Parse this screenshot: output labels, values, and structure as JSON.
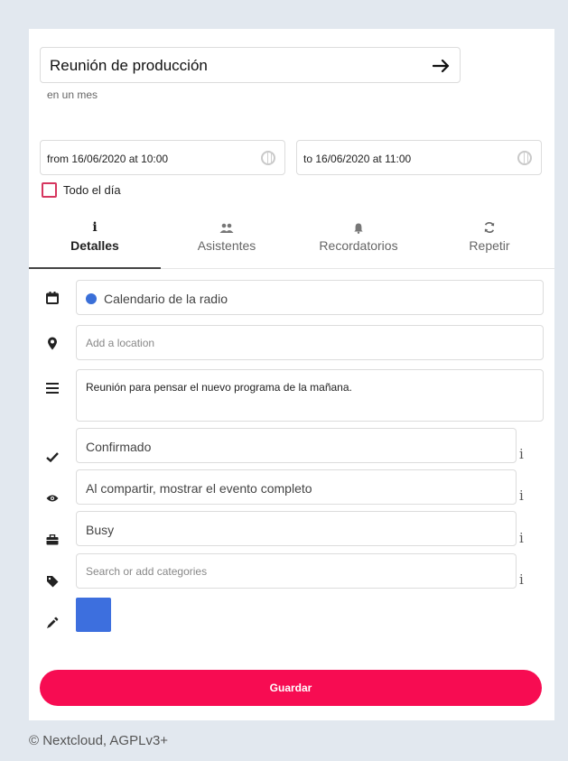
{
  "event": {
    "title": "Reunión de producción",
    "relative_time": "en un mes",
    "from": "from 16/06/2020 at 10:00",
    "to": "to 16/06/2020 at 11:00",
    "all_day_label": "Todo el día",
    "all_day_checked": false
  },
  "tabs": [
    {
      "icon": "i",
      "icon_name": "info-icon",
      "label": "Detalles",
      "active": true
    },
    {
      "icon": "people",
      "icon_name": "attendees-icon",
      "label": "Asistentes",
      "active": false
    },
    {
      "icon": "bell",
      "icon_name": "bell-icon",
      "label": "Recordatorios",
      "active": false
    },
    {
      "icon": "repeat",
      "icon_name": "repeat-icon",
      "label": "Repetir",
      "active": false
    }
  ],
  "details": {
    "calendar": "Calendario de la radio",
    "calendar_color": "#3a6fd8",
    "location_placeholder": "Add a location",
    "description": "Reunión para pensar el nuevo programa de la mañana.",
    "status": "Confirmado",
    "visibility": "Al compartir, mostrar el evento completo",
    "availability": "Busy",
    "categories_placeholder": "Search or add categories",
    "info_glyph": "i",
    "event_color": "#3d6fde"
  },
  "actions": {
    "save_label": "Guardar",
    "save_color": "#f70c52"
  },
  "footer": {
    "credit": "© Nextcloud, AGPLv3+"
  }
}
